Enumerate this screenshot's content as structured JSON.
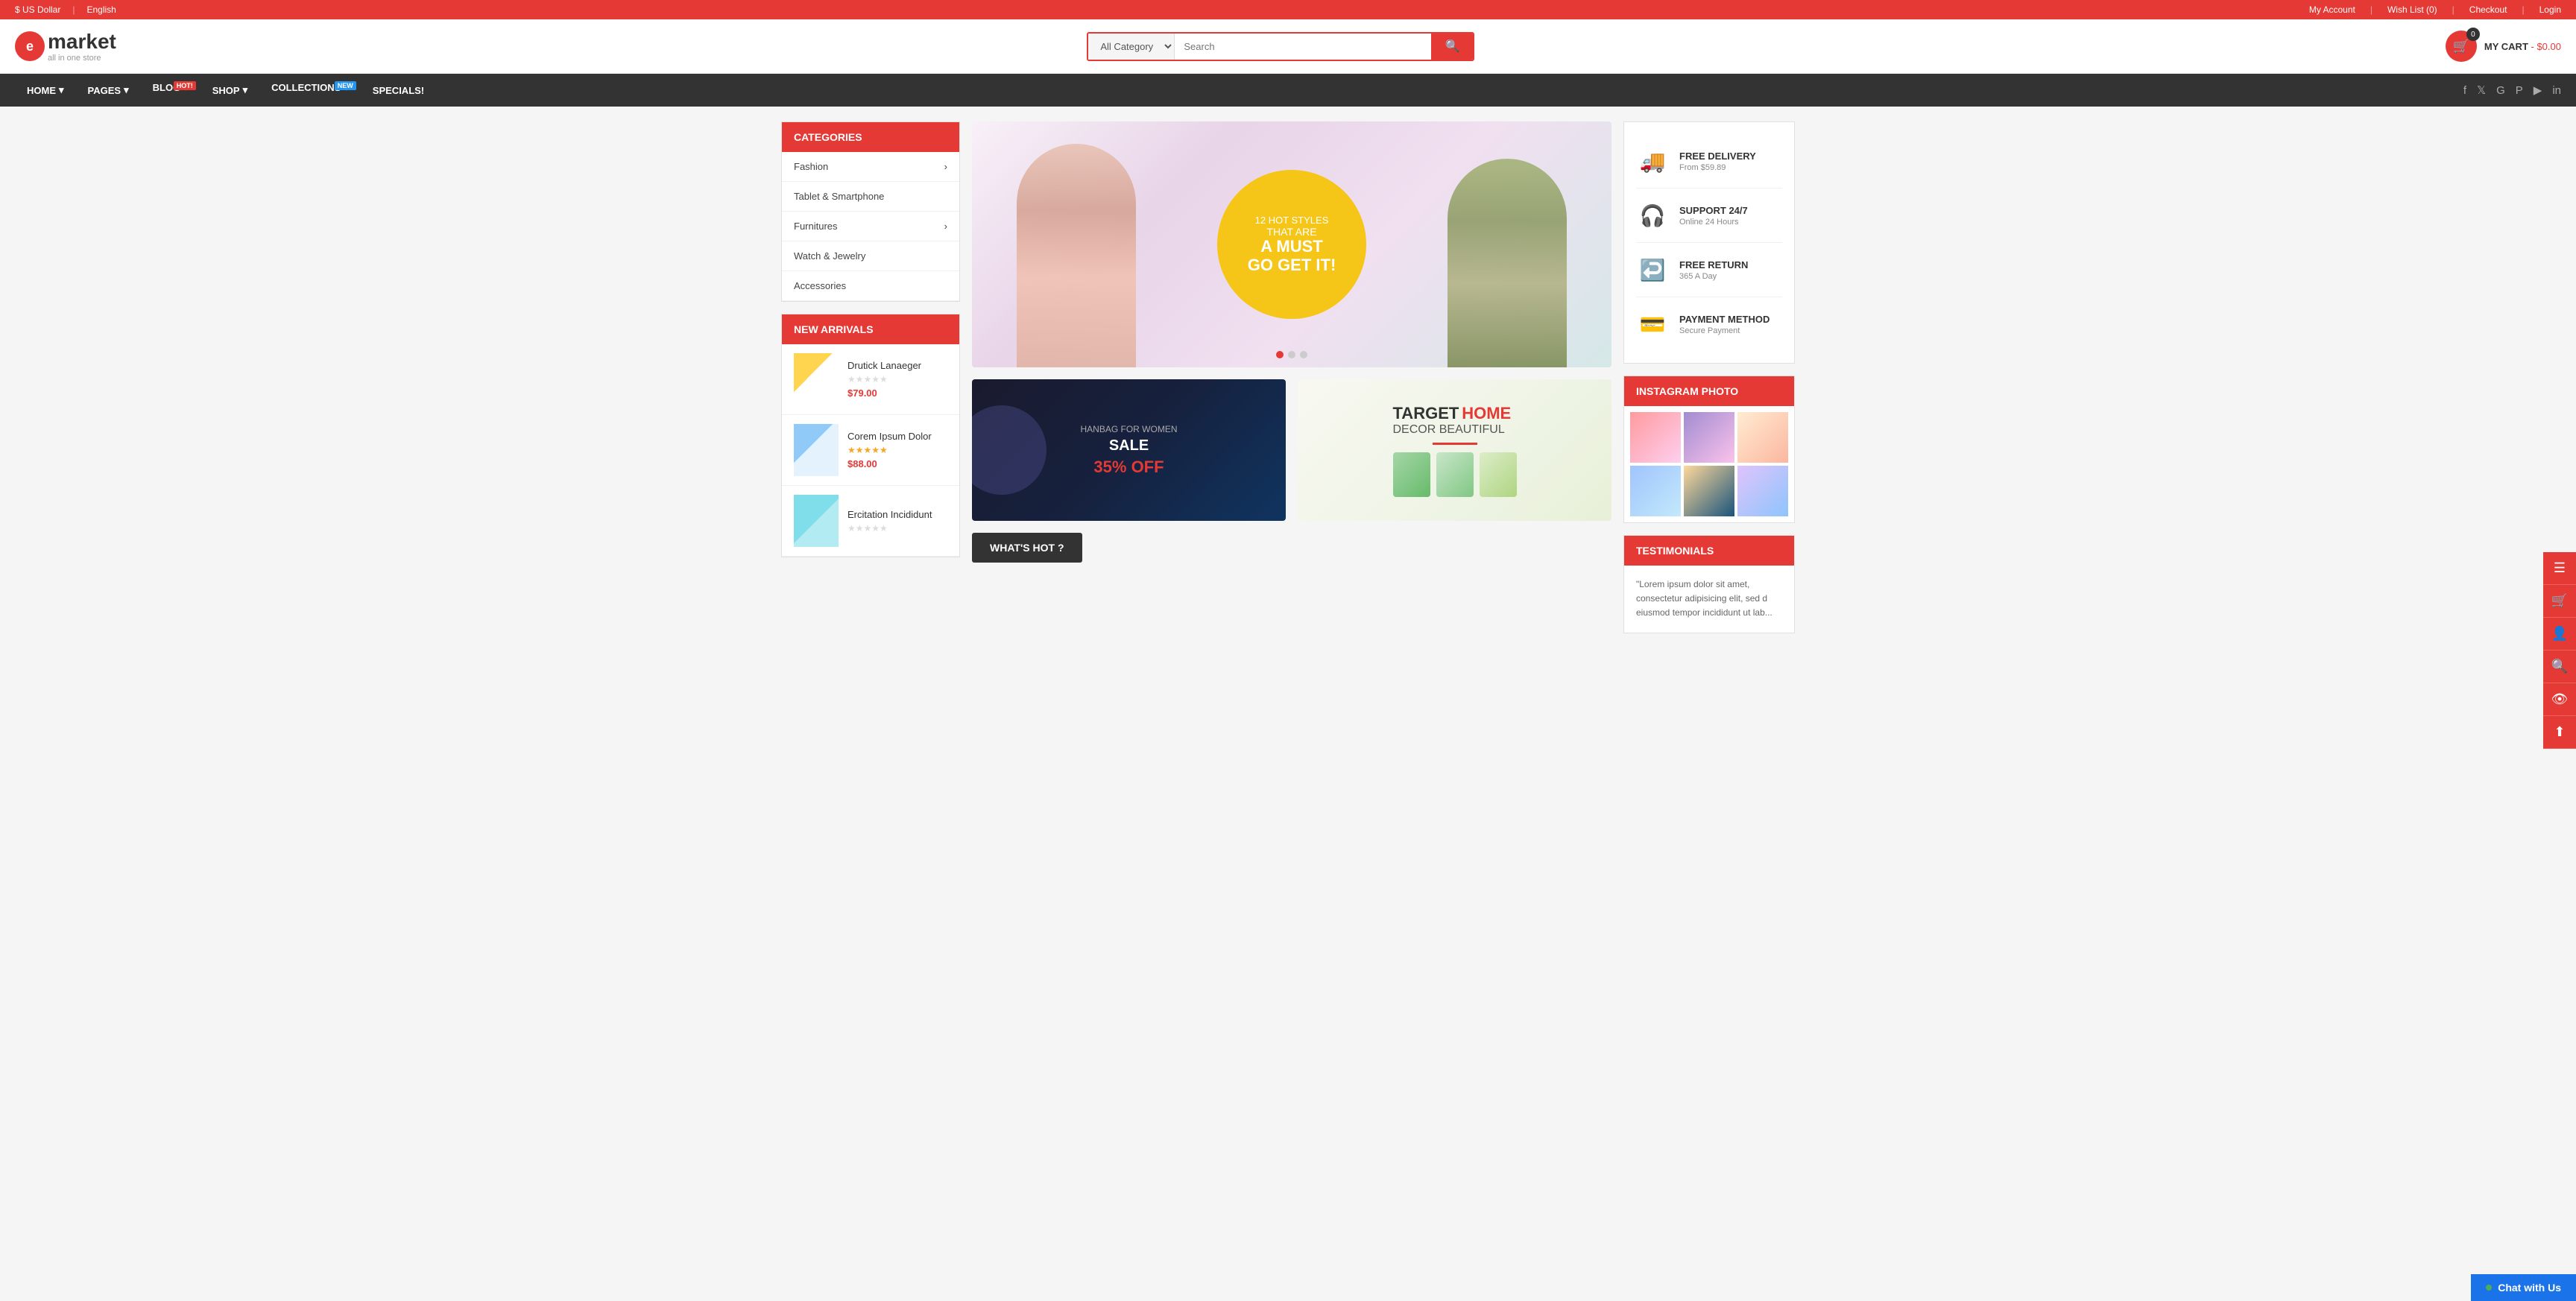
{
  "topbar": {
    "currency": "$ US Dollar",
    "language": "English",
    "my_account": "My Account",
    "wishlist": "Wish List (0)",
    "checkout": "Checkout",
    "login": "Login"
  },
  "header": {
    "logo_letter": "e",
    "logo_name": "market",
    "logo_sub": "all in one store",
    "search_placeholder": "Search",
    "search_category": "All Category",
    "cart_count": "0",
    "cart_label": "MY CART",
    "cart_price": "- $0.00"
  },
  "nav": {
    "items": [
      {
        "label": "HOME",
        "badge": ""
      },
      {
        "label": "PAGES",
        "badge": ""
      },
      {
        "label": "BLOG",
        "badge": "Hot!"
      },
      {
        "label": "SHOP",
        "badge": ""
      },
      {
        "label": "COLLECTIONS",
        "badge": "New"
      },
      {
        "label": "SPECIALS!",
        "badge": ""
      }
    ]
  },
  "categories": {
    "header": "CATEGORIES",
    "items": [
      {
        "label": "Fashion",
        "has_arrow": true
      },
      {
        "label": "Tablet & Smartphone",
        "has_arrow": false
      },
      {
        "label": "Furnitures",
        "has_arrow": true
      },
      {
        "label": "Watch & Jewelry",
        "has_arrow": false
      },
      {
        "label": "Accessories",
        "has_arrow": false
      }
    ]
  },
  "new_arrivals": {
    "header": "NEW ARRIVALS",
    "items": [
      {
        "name": "Drutick Lanaeger",
        "price": "$79.00",
        "stars": 0
      },
      {
        "name": "Corem Ipsum Dolor",
        "price": "$88.00",
        "stars": 5
      },
      {
        "name": "Ercitation Incididunt",
        "price": "",
        "stars": 0
      }
    ]
  },
  "hero": {
    "circle_line1": "12 HOT STYLES",
    "circle_line2": "THAT ARE",
    "circle_line3": "A MUST\nGO GET IT!"
  },
  "banner_dark": {
    "sub": "HANBAG FOR WOMEN",
    "title": "SALE",
    "discount": "35% OFF"
  },
  "banner_light": {
    "target": "TARGET",
    "home": "HOME",
    "decor": "DECOR BEAUTIFUL"
  },
  "whats_hot": {
    "label": "WHAT'S HOT ?"
  },
  "features": {
    "items": [
      {
        "icon": "🚚",
        "title": "FREE DELIVERY",
        "sub": "From $59.89"
      },
      {
        "icon": "🎧",
        "title": "SUPPORT 24/7",
        "sub": "Online 24 Hours"
      },
      {
        "icon": "↩",
        "title": "FREE RETURN",
        "sub": "365 A Day"
      },
      {
        "icon": "💳",
        "title": "PAYMENT METHOD",
        "sub": "Secure Payment"
      }
    ]
  },
  "instagram": {
    "header": "INSTAGRAM PHOTO"
  },
  "testimonials": {
    "header": "TESTIMONIALS",
    "content": "\"Lorem ipsum dolor sit amet, consectetur adipisicing elit, sed d eiusmod tempor incididunt ut lab..."
  },
  "chat": {
    "label": "Chat with Us"
  }
}
